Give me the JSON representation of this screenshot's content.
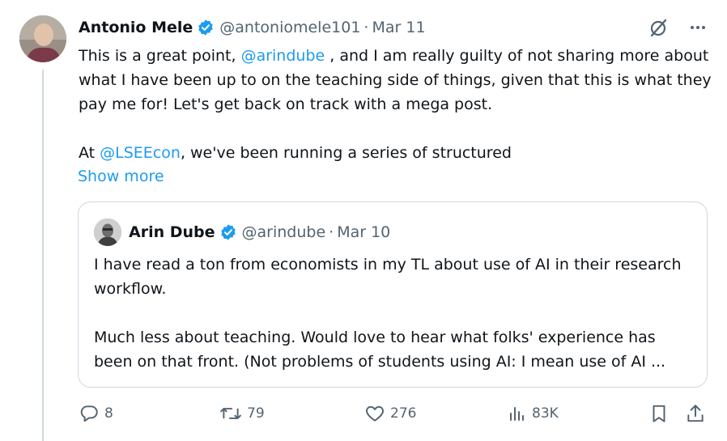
{
  "tweet": {
    "author_name": "Antonio Mele",
    "handle": "@antoniomele101",
    "separator": "·",
    "date": "Mar 11",
    "text": {
      "line1_prefix": "This is a great point, ",
      "mention1": "@arindube",
      "line1_suffix": " , and I am really guilty of not sharing more about what I have been up to on the teaching side of things, given that this is what they pay me for! Let's get back on track with a mega post.",
      "line2_prefix": "At ",
      "mention2": "@LSEEcon",
      "line2_suffix": ", we've been running a series of structured"
    },
    "show_more": "Show more"
  },
  "quote": {
    "author_name": "Arin Dube",
    "handle": "@arindube",
    "separator": "·",
    "date": "Mar 10",
    "para1": "I have read a ton from economists in my TL about use of AI in their research workflow.",
    "para2": "Much less about teaching. Would love to hear what folks' experience has been on that front. (Not problems of students using AI: I mean use of AI ..."
  },
  "actions": {
    "replies": "8",
    "retweets": "79",
    "likes": "276",
    "views": "83K"
  },
  "icons": {
    "verified": "verified-badge-icon",
    "grok": "grok-icon",
    "more": "more-options-icon",
    "reply": "reply-icon",
    "retweet": "retweet-icon",
    "like": "heart-icon",
    "views": "views-icon",
    "bookmark": "bookmark-icon",
    "share": "share-icon"
  },
  "colors": {
    "link": "#1d9bf0",
    "text": "#0f1419",
    "muted": "#536471",
    "border": "#cfd9de"
  }
}
